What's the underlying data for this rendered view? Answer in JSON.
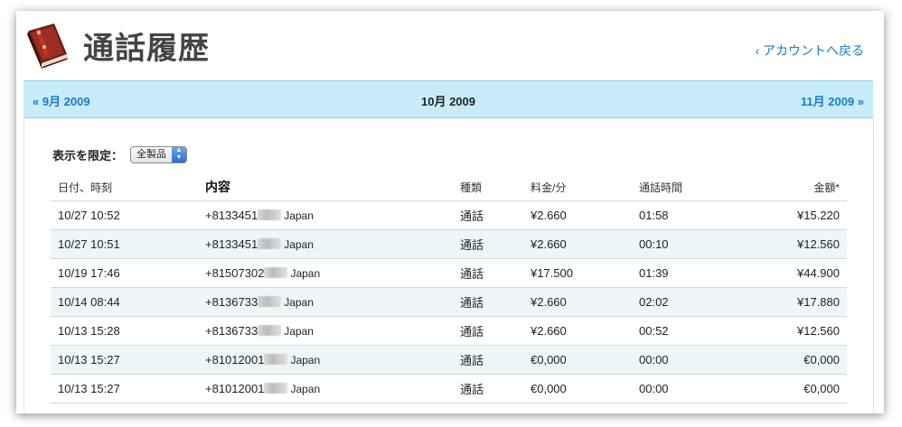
{
  "header": {
    "title": "通話履歴",
    "back_link": "‹ アカウントへ戻る",
    "logo_icon": "address-book-icon"
  },
  "month_nav": {
    "prev": "« 9月 2009",
    "current": "10月 2009",
    "next": "11月 2009 »",
    "background": "#c7ecf8"
  },
  "filter": {
    "label": "表示を限定：",
    "selected": "全製品"
  },
  "table": {
    "headers": {
      "date": "日付、時刻",
      "description": "内容",
      "type": "種類",
      "rate": "料金/分",
      "duration": "通話時間",
      "amount": "金額*"
    },
    "rows": [
      {
        "date": "10/27 10:52",
        "number": "+8133451",
        "country": "Japan",
        "type": "通話",
        "rate": "¥2.660",
        "duration": "01:58",
        "amount": "¥15.220"
      },
      {
        "date": "10/27 10:51",
        "number": "+8133451",
        "country": "Japan",
        "type": "通話",
        "rate": "¥2.660",
        "duration": "00:10",
        "amount": "¥12.560"
      },
      {
        "date": "10/19 17:46",
        "number": "+81507302",
        "country": "Japan",
        "type": "通話",
        "rate": "¥17.500",
        "duration": "01:39",
        "amount": "¥44.900"
      },
      {
        "date": "10/14 08:44",
        "number": "+8136733",
        "country": "Japan",
        "type": "通話",
        "rate": "¥2.660",
        "duration": "02:02",
        "amount": "¥17.880"
      },
      {
        "date": "10/13 15:28",
        "number": "+8136733",
        "country": "Japan",
        "type": "通話",
        "rate": "¥2.660",
        "duration": "00:52",
        "amount": "¥12.560"
      },
      {
        "date": "10/13 15:27",
        "number": "+81012001",
        "country": "Japan",
        "type": "通話",
        "rate": "€0,000",
        "duration": "00:00",
        "amount": "€0,000"
      },
      {
        "date": "10/13 15:27",
        "number": "+81012001",
        "country": "Japan",
        "type": "通話",
        "rate": "€0,000",
        "duration": "00:00",
        "amount": "€0,000"
      }
    ]
  }
}
